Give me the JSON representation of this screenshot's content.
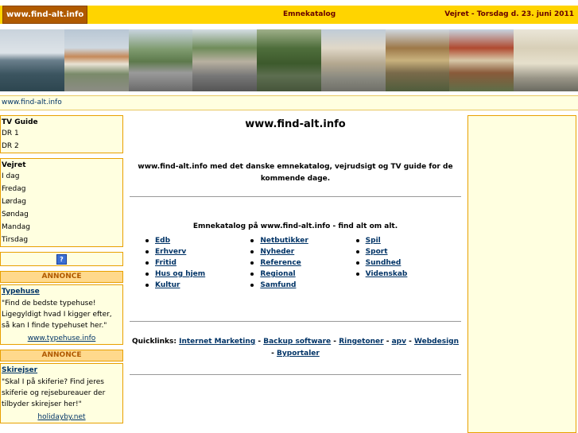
{
  "header": {
    "logo": "www.find-alt.info",
    "catalog_link": "Emnekatalog",
    "weather_date": "Vejret - Torsdag d. 23. juni 2011"
  },
  "breadcrumb": "www.find-alt.info",
  "tvguide": {
    "title": "TV Guide",
    "items": [
      "DR 1",
      "DR 2"
    ]
  },
  "weather": {
    "title": "Vejret",
    "items": [
      "I dag",
      "Fredag",
      "Lørdag",
      "Søndag",
      "Mandag",
      "Tirsdag"
    ]
  },
  "ads": [
    {
      "header": "ANNONCE",
      "title": "Typehuse",
      "text": "\"Find de bedste typehuse! Ligegyldigt hvad I kigger efter, så kan I finde typehuset her.\"",
      "link": "www.typehuse.info"
    },
    {
      "header": "ANNONCE",
      "title": "Skirejser",
      "text": "\"Skal I på skiferie? Find jeres skiferie og rejsebureauer der tilbyder skirejser her!\"",
      "link": "holidayby.net"
    }
  ],
  "main": {
    "title": "www.find-alt.info",
    "intro": "www.find-alt.info med det danske emnekatalog, vejrudsigt og TV guide for de kommende dage.",
    "catalog_heading": "Emnekatalog på www.find-alt.info - find alt om alt.",
    "categories": [
      [
        "Edb",
        "Erhverv",
        "Fritid",
        "Hus og hjem",
        "Kultur"
      ],
      [
        "Netbutikker",
        "Nyheder",
        "Reference",
        "Regional",
        "Samfund"
      ],
      [
        "Spil",
        "Sport",
        "Sundhed",
        "Videnskab"
      ]
    ],
    "quicklinks_label": "Quicklinks:",
    "quicklinks": [
      "Internet Marketing",
      "Backup software",
      "Ringetoner",
      "apv",
      "Webdesign",
      "Byportaler"
    ]
  },
  "colors": {
    "header_bg": "#ffd400",
    "box_bg": "#ffffe0",
    "border": "#e8a000",
    "link": "#003366"
  }
}
